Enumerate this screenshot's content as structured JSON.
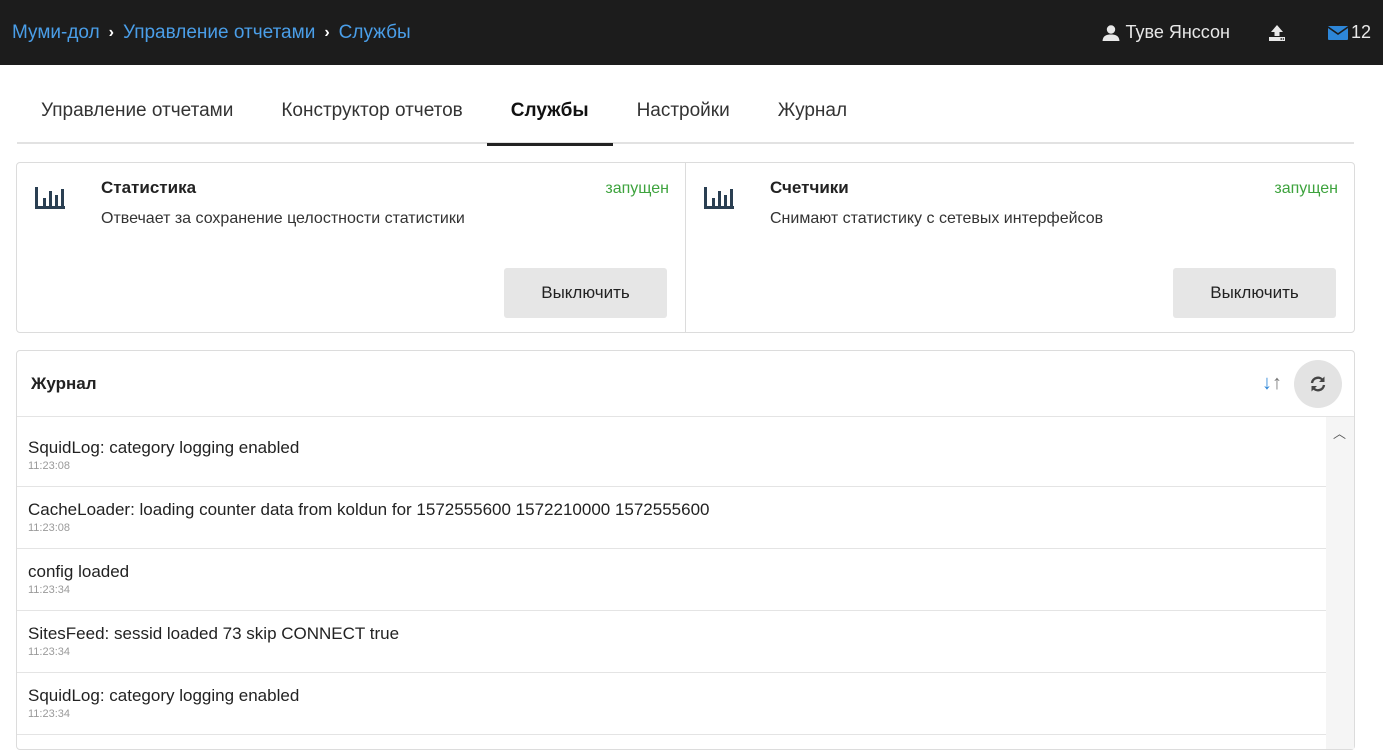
{
  "header": {
    "breadcrumbs": [
      "Муми-дол",
      "Управление отчетами",
      "Службы"
    ],
    "user_name": "Туве Янссон",
    "mail_count": "12",
    "colors": {
      "bar": "#1c1c1c",
      "link": "#4a9ee8"
    },
    "icons": {
      "user": "user-icon",
      "upload": "upload-icon",
      "mail": "envelope-icon"
    }
  },
  "tabs": [
    {
      "label": "Управление отчетами",
      "active": false
    },
    {
      "label": "Конструктор отчетов",
      "active": false
    },
    {
      "label": "Службы",
      "active": true
    },
    {
      "label": "Настройки",
      "active": false
    },
    {
      "label": "Журнал",
      "active": false
    }
  ],
  "services": [
    {
      "title": "Статистика",
      "status": "запущен",
      "description": "Отвечает за сохранение целостности статистики",
      "button": "Выключить",
      "icon": "bar-chart-icon"
    },
    {
      "title": "Счетчики",
      "status": "запущен",
      "description": "Снимают статистику с сетевых интерфейсов",
      "button": "Выключить",
      "icon": "bar-chart-icon"
    }
  ],
  "journal": {
    "title": "Журнал",
    "icons": {
      "sort_desc": "arrow-down-icon",
      "sort_asc": "arrow-up-icon",
      "refresh": "refresh-icon"
    },
    "entries": [
      {
        "message": "SquidLog: category logging enabled",
        "time": "11:23:08"
      },
      {
        "message": "CacheLoader: loading counter data from koldun for 1572555600 1572210000 1572555600",
        "time": "11:23:08"
      },
      {
        "message": "config loaded",
        "time": "11:23:34"
      },
      {
        "message": "SitesFeed: sessid loaded 73 skip CONNECT true",
        "time": "11:23:34"
      },
      {
        "message": "SquidLog: category logging enabled",
        "time": "11:23:34"
      }
    ]
  },
  "status_color": "#3ea33e"
}
